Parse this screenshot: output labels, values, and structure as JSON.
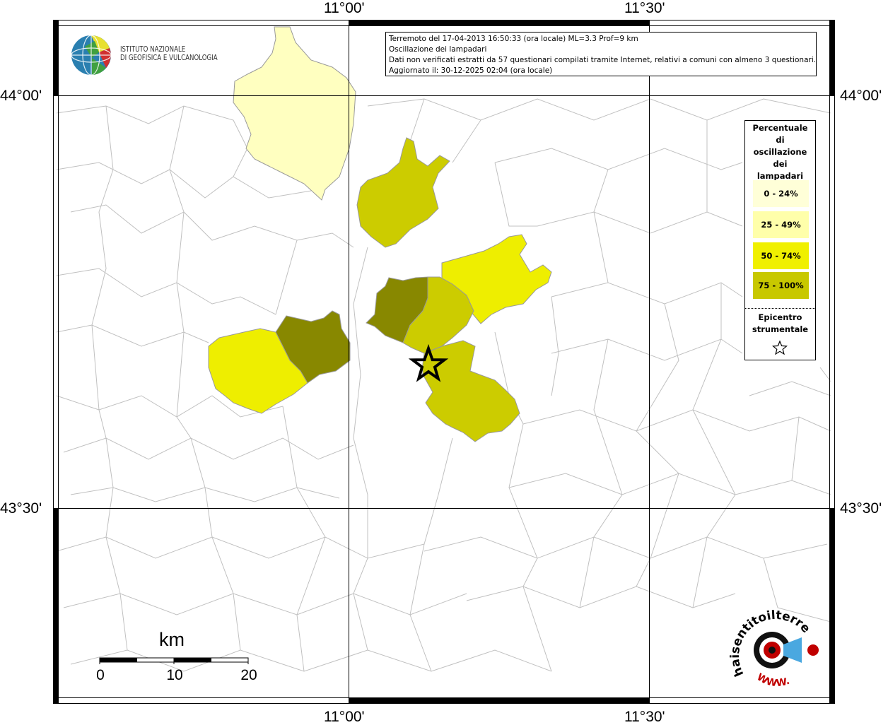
{
  "info": {
    "line1": "Terremoto del 17-04-2013 16:50:33 (ora locale) ML=3.3 Prof=9 km",
    "line2": "Oscillazione dei lampadari",
    "line3": "Dati non verificati estratti da 57 questionari compilati tramite Internet, relativi a comuni con almeno 3 questionari.",
    "line4": "Aggiornato il: 30-12-2025 02:04 (ora locale)"
  },
  "ingv_logo": {
    "line1": "ISTITUTO NAZIONALE",
    "line2": "DI GEOFISICA E VULCANOLOGIA"
  },
  "axis_labels": {
    "top": [
      "11°00'",
      "11°30'"
    ],
    "bottom": [
      "11°00'",
      "11°30'"
    ],
    "left": [
      "44°00'",
      "43°30'"
    ],
    "right": [
      "44°00'",
      "43°30'"
    ]
  },
  "legend": {
    "title": [
      "Percentuale",
      "di",
      "oscillazione",
      "dei",
      "lampadari"
    ],
    "classes": [
      {
        "label": "0 - 24%",
        "color": "#ffffc8"
      },
      {
        "label": "25 - 49%",
        "color": "#ffffaa"
      },
      {
        "label": "50 - 74%",
        "color": "#f0f000"
      },
      {
        "label": "75 - 100%",
        "color": "#d0d000"
      }
    ],
    "epicenter": [
      "Epicentro",
      "strumentale"
    ]
  },
  "scale": {
    "unit": "km",
    "ticks": [
      "0",
      "10",
      "20"
    ]
  },
  "hst_logo": {
    "text": "haisentitoilterremoto.it",
    "www": "WWW."
  },
  "colors": {
    "c0": "#ffffc0",
    "c50": "#eeee00",
    "c75": "#cccc00",
    "c100": "#888800",
    "border": "#bbbbbb"
  }
}
